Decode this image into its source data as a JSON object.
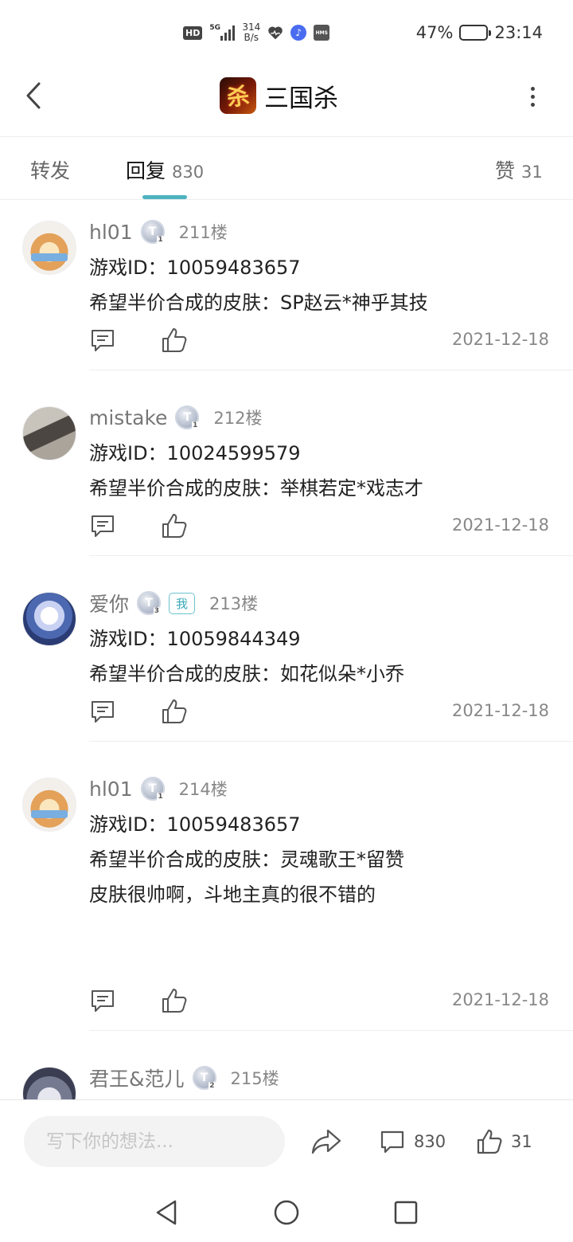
{
  "status_bar": {
    "hd": "HD",
    "network": "5G",
    "speed_value": "314",
    "speed_unit": "B/s",
    "hms": "HMS",
    "battery_percent": "47%",
    "battery_level": 0.47,
    "time": "23:14"
  },
  "header": {
    "logo_char": "杀",
    "title": "三国杀"
  },
  "tabs": [
    {
      "label": "转发",
      "count": ""
    },
    {
      "label": "回复",
      "count": "830"
    },
    {
      "label": "赞",
      "count": "31"
    }
  ],
  "replies": [
    {
      "username": "hl01",
      "level": "T",
      "level_num": "1",
      "floor": "211楼",
      "lines": [
        "游戏ID：10059483657",
        "希望半价合成的皮肤：SP赵云*神乎其技"
      ],
      "date": "2021-12-18"
    },
    {
      "username": "mistake",
      "level": "T",
      "level_num": "1",
      "floor": "212楼",
      "lines": [
        "游戏ID：10024599579",
        "希望半价合成的皮肤：举棋若定*戏志才"
      ],
      "date": "2021-12-18"
    },
    {
      "username": "爱你",
      "level": "T",
      "level_num": "3",
      "me_badge": "我",
      "floor": "213楼",
      "lines": [
        "游戏ID：10059844349",
        "希望半价合成的皮肤：如花似朵*小乔"
      ],
      "date": "2021-12-18"
    },
    {
      "username": "hl01",
      "level": "T",
      "level_num": "1",
      "floor": "214楼",
      "lines": [
        "游戏ID：10059483657",
        "希望半价合成的皮肤：灵魂歌王*留赞",
        "皮肤很帅啊，斗地主真的很不错的"
      ],
      "date": "2021-12-18"
    },
    {
      "username": "君王&范儿",
      "level": "T",
      "level_num": "2",
      "floor": "215楼"
    }
  ],
  "bottom_bar": {
    "input_placeholder": "写下你的想法...",
    "comment_count": "830",
    "like_count": "31"
  }
}
